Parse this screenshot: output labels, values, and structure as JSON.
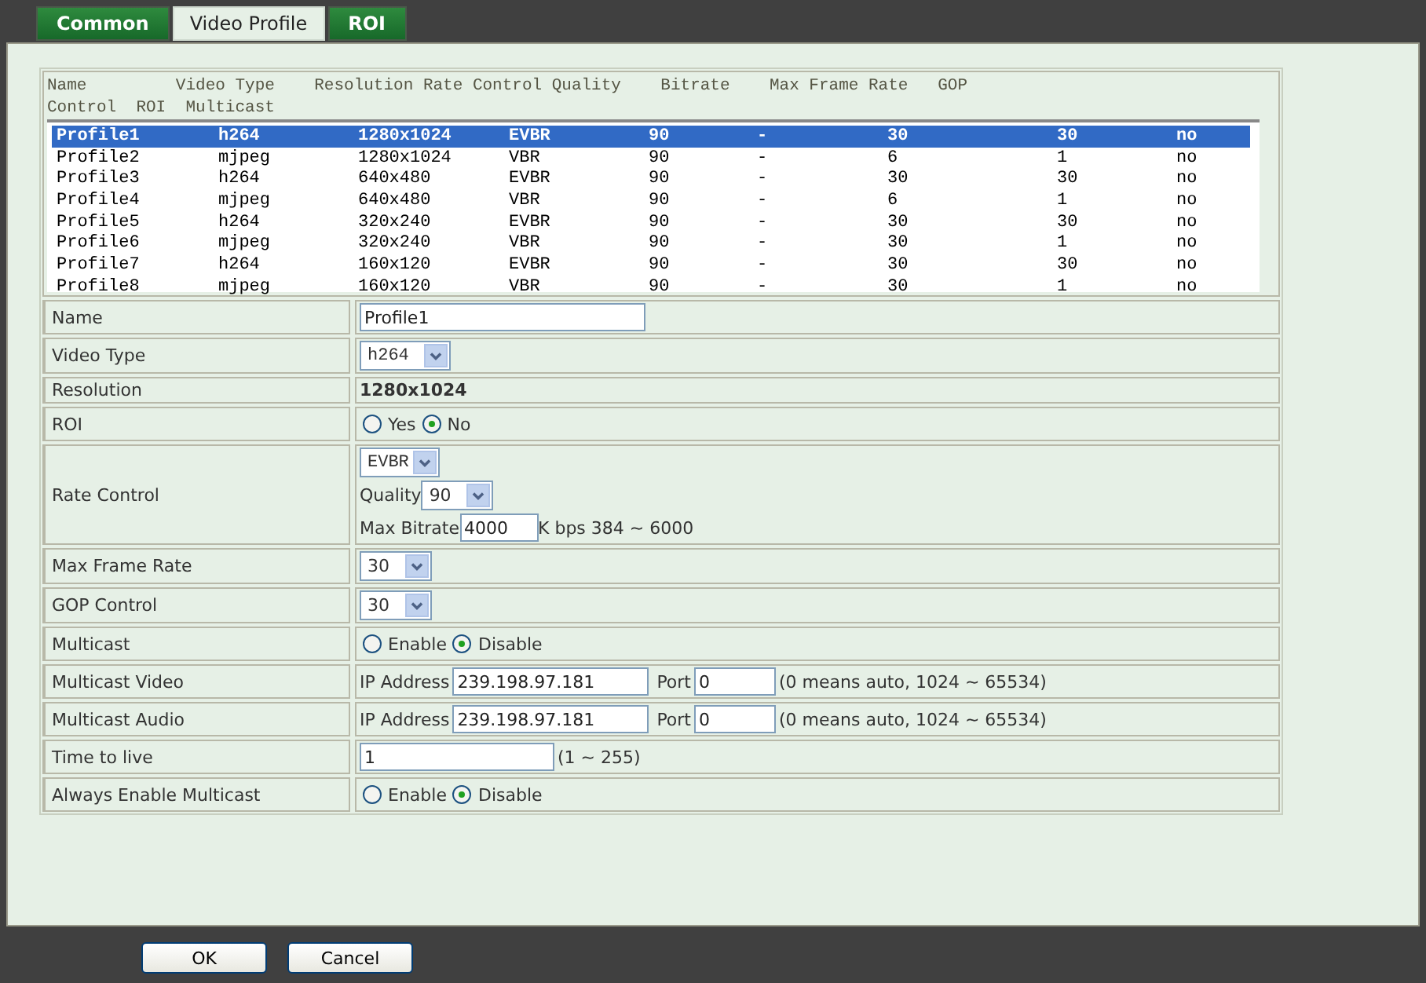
{
  "tabs": [
    {
      "label": "Common",
      "selected": false
    },
    {
      "label": "Video Profile",
      "selected": true
    },
    {
      "label": "ROI",
      "selected": false
    }
  ],
  "profile_list": {
    "header_lines": [
      "Name         Video Type    Resolution Rate Control Quality    Bitrate    Max Frame Rate   GOP",
      "Control  ROI  Multicast"
    ],
    "rows": [
      {
        "selected": true,
        "cells": [
          "Profile1",
          "h264",
          "1280x1024",
          "EVBR",
          "90",
          "-",
          "30",
          "30",
          "no"
        ]
      },
      {
        "selected": false,
        "cells": [
          "Profile2",
          "mjpeg",
          "1280x1024",
          "VBR",
          "90",
          "-",
          "6",
          "1",
          "no"
        ]
      },
      {
        "selected": false,
        "cells": [
          "Profile3",
          "h264",
          "640x480",
          "EVBR",
          "90",
          "-",
          "30",
          "30",
          "no"
        ]
      },
      {
        "selected": false,
        "cells": [
          "Profile4",
          "mjpeg",
          "640x480",
          "VBR",
          "90",
          "-",
          "6",
          "1",
          "no"
        ]
      },
      {
        "selected": false,
        "cells": [
          "Profile5",
          "h264",
          "320x240",
          "EVBR",
          "90",
          "-",
          "30",
          "30",
          "no"
        ]
      },
      {
        "selected": false,
        "cells": [
          "Profile6",
          "mjpeg",
          "320x240",
          "VBR",
          "90",
          "-",
          "30",
          "1",
          "no"
        ]
      },
      {
        "selected": false,
        "cells": [
          "Profile7",
          "h264",
          "160x120",
          "EVBR",
          "90",
          "-",
          "30",
          "30",
          "no"
        ]
      },
      {
        "selected": false,
        "cells": [
          "Profile8",
          "mjpeg",
          "160x120",
          "VBR",
          "90",
          "-",
          "30",
          "1",
          "no"
        ]
      }
    ]
  },
  "form": [
    {
      "label": "Name",
      "kind": "text",
      "value": "Profile1"
    },
    {
      "label": "Video Type",
      "kind": "select",
      "value": "h264"
    },
    {
      "label": "Resolution",
      "kind": "static",
      "value": "1280x1024"
    },
    {
      "label": "ROI",
      "kind": "radio",
      "options": [
        {
          "label": "Yes",
          "selected": false
        },
        {
          "label": "No",
          "selected": true
        }
      ]
    },
    {
      "label": "Rate Control",
      "kind": "rate",
      "value": "EVBR",
      "quality_label": "Quality",
      "quality": "90",
      "bitrate_label": "Max Bitrate",
      "bitrate": "4000",
      "hint": "K bps 384 ~ 6000"
    },
    {
      "label": "Max Frame Rate",
      "kind": "select",
      "value": "30"
    },
    {
      "label": "GOP Control",
      "kind": "select",
      "value": "30"
    },
    {
      "label": "Multicast",
      "kind": "radio",
      "options": [
        {
          "label": "Enable",
          "selected": false
        },
        {
          "label": "Disable",
          "selected": true
        }
      ]
    },
    {
      "label": "Multicast Video",
      "kind": "address",
      "ip_label": "IP Address",
      "ip": "239.198.97.181",
      "port_label": "Port",
      "port": "0",
      "hint": "(0 means auto, 1024 ~ 65534)"
    },
    {
      "label": "Multicast Audio",
      "kind": "address",
      "ip_label": "IP Address",
      "ip": "239.198.97.181",
      "port_label": "Port",
      "port": "0",
      "hint": "(0 means auto, 1024 ~ 65534)"
    },
    {
      "label": "Time to live",
      "kind": "text",
      "value": "1",
      "hint": "(1 ~ 255)"
    },
    {
      "label": "Always Enable Multicast",
      "kind": "radio",
      "options": [
        {
          "label": "Enable",
          "selected": false
        },
        {
          "label": "Disable",
          "selected": true
        }
      ]
    }
  ],
  "buttons": [
    "OK",
    "Cancel"
  ]
}
